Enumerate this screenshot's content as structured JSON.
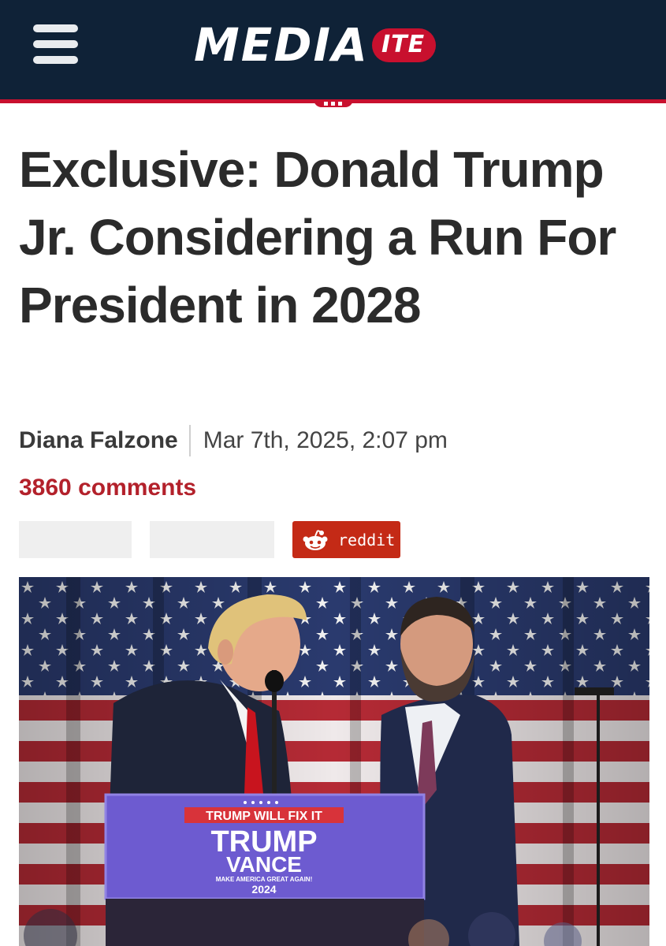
{
  "header": {
    "logo_text": "MEDIA",
    "logo_badge": "ITE",
    "menu_icon": "hamburger-menu-icon"
  },
  "article": {
    "headline": "Exclusive: Donald Trump Jr. Considering a Run For President in 2028",
    "author": "Diana Falzone",
    "date": "Mar 7th, 2025, 2:07 pm",
    "comments": "3860 comments"
  },
  "share": {
    "reddit_label": "reddit",
    "reddit_icon": "reddit-alien-icon"
  },
  "photo": {
    "podium_banner": "TRUMP WILL FIX IT",
    "podium_line1": "TRUMP",
    "podium_line2": "VANCE",
    "podium_slogan": "MAKE AMERICA GREAT AGAIN!",
    "podium_year": "2024"
  },
  "colors": {
    "header_bg": "#0f2237",
    "accent_red": "#c8102e",
    "comments_red": "#b3212b",
    "reddit_bg": "#c42a16"
  }
}
